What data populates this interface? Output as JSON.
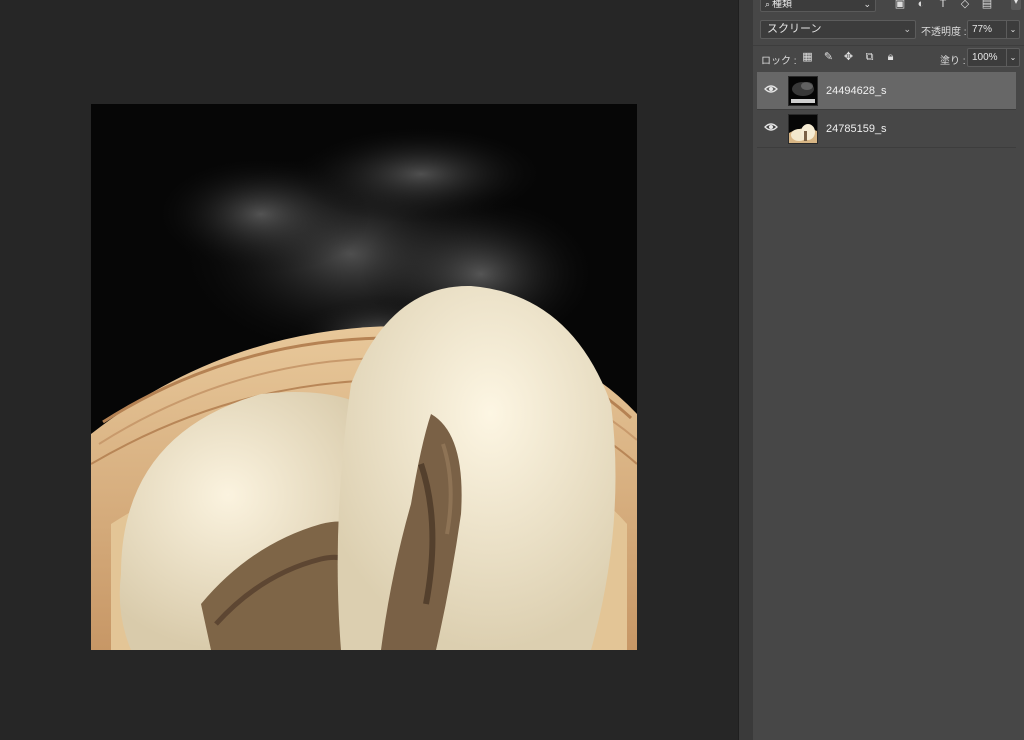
{
  "layers_panel": {
    "filter_label": "種類",
    "filter_icons": [
      "image-filter-icon",
      "adjustment-filter-icon",
      "type-filter-icon",
      "shape-filter-icon",
      "smart-object-filter-icon"
    ],
    "blend_mode": "スクリーン",
    "opacity_label": "不透明度 :",
    "opacity_value": "77%",
    "lock_label": "ロック :",
    "lock_icons": [
      "lock-transparent-icon",
      "lock-image-icon",
      "lock-position-icon",
      "lock-artboard-icon",
      "lock-all-icon"
    ],
    "fill_label": "塗り :",
    "fill_value": "100%",
    "layers": [
      {
        "name": "24494628_s",
        "selected": true,
        "visible": true
      },
      {
        "name": "24785159_s",
        "selected": false,
        "visible": true
      }
    ]
  },
  "canvas": {
    "description_icon": "document-canvas"
  },
  "colors": {
    "workspace": "#262626",
    "panel": "#474747",
    "selected_layer": "#676767"
  }
}
